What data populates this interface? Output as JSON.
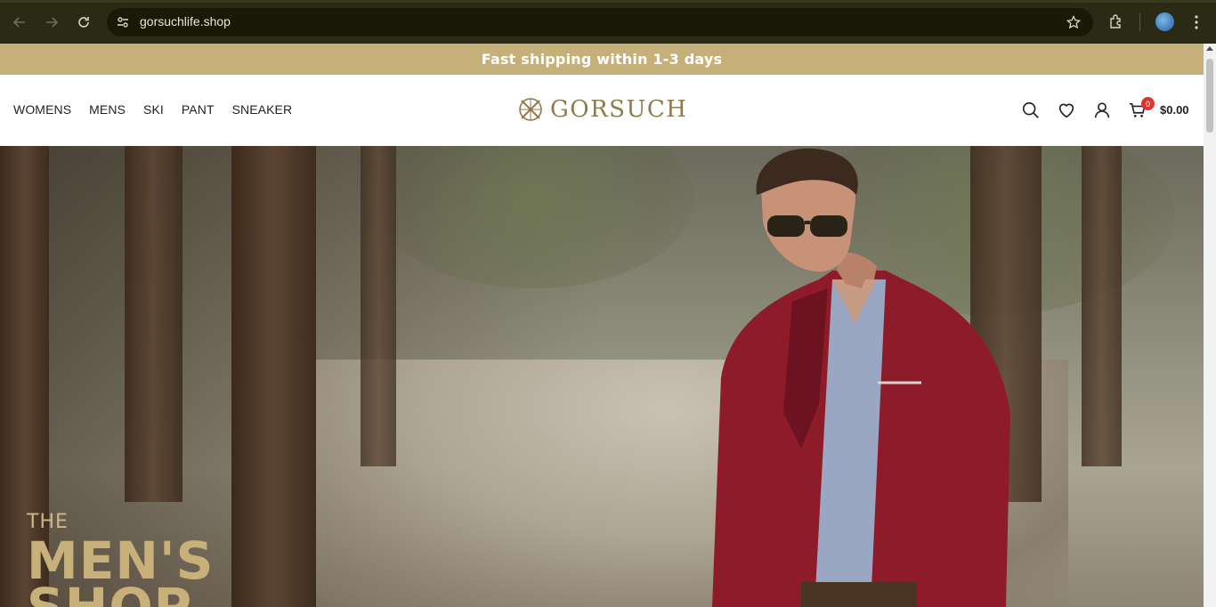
{
  "browser": {
    "url": "gorsuchlife.shop",
    "icons": [
      "back-arrow-icon",
      "forward-arrow-icon",
      "reload-icon",
      "site-info-icon",
      "bookmark-star-icon",
      "extensions-icon",
      "profile-avatar",
      "kebab-menu-icon"
    ]
  },
  "promo": {
    "text": "Fast shipping within 1-3 days"
  },
  "header": {
    "nav": [
      {
        "label": "WOMENS"
      },
      {
        "label": "MENS"
      },
      {
        "label": "SKI"
      },
      {
        "label": "PANT"
      },
      {
        "label": "SNEAKER"
      }
    ],
    "logo_text": "GORSUCH",
    "cart_count": "0",
    "cart_total": "$0.00",
    "icons": [
      "search-icon",
      "wishlist-heart-icon",
      "account-user-icon",
      "cart-icon"
    ]
  },
  "hero": {
    "eyebrow": "THE",
    "title_line1": "MEN'S",
    "title_line2": "SHOP"
  },
  "colors": {
    "promo_bg": "#c6b07a",
    "hero_title": "#c8b07a",
    "logo": "#8f7a4a",
    "browser_bar": "#2b2a14",
    "cart_badge": "#e0332f"
  }
}
